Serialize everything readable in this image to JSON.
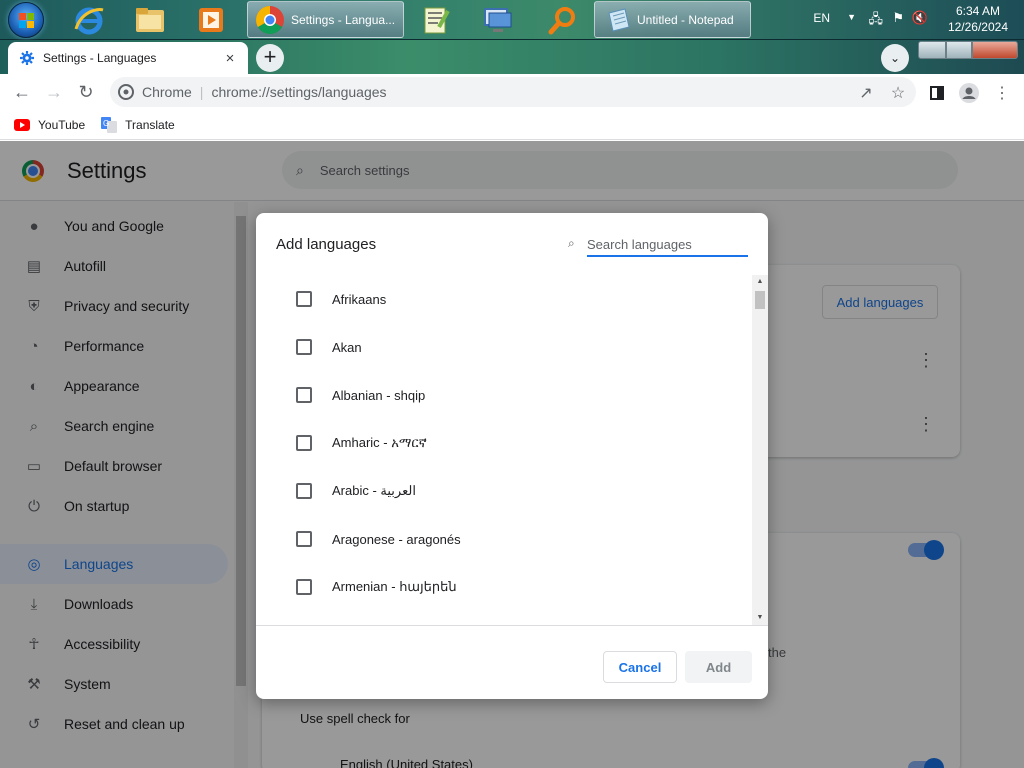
{
  "taskbar": {
    "tasks": [
      {
        "label": "Settings - Langua..."
      },
      {
        "label": "Untitled - Notepad"
      }
    ],
    "tray": {
      "language": "EN",
      "time": "6:34 AM",
      "date": "12/26/2024"
    }
  },
  "browser": {
    "tab_title": "Settings - Languages",
    "close_label": "×",
    "new_tab_label": "+",
    "site_label": "Chrome",
    "url": "chrome://settings/languages",
    "bookmarks": [
      {
        "label": "YouTube",
        "icon": "youtube-icon"
      },
      {
        "label": "Translate",
        "icon": "translate-icon"
      }
    ]
  },
  "settings": {
    "title": "Settings",
    "search_placeholder": "Search settings",
    "sidebar": [
      {
        "label": "You and Google",
        "icon": "person-icon"
      },
      {
        "label": "Autofill",
        "icon": "clipboard-icon"
      },
      {
        "label": "Privacy and security",
        "icon": "shield-icon"
      },
      {
        "label": "Performance",
        "icon": "gauge-icon"
      },
      {
        "label": "Appearance",
        "icon": "palette-icon"
      },
      {
        "label": "Search engine",
        "icon": "search-icon"
      },
      {
        "label": "Default browser",
        "icon": "browser-icon"
      },
      {
        "label": "On startup",
        "icon": "power-icon"
      },
      {
        "label": "Languages",
        "icon": "globe-icon",
        "active": true
      },
      {
        "label": "Downloads",
        "icon": "download-icon"
      },
      {
        "label": "Accessibility",
        "icon": "accessibility-icon"
      },
      {
        "label": "System",
        "icon": "wrench-icon"
      },
      {
        "label": "Reset and clean up",
        "icon": "reset-icon"
      }
    ],
    "add_languages_button": "Add languages",
    "partial_text_the": "the",
    "use_spell_check_for": "Use spell check for",
    "spell_check_language": "English (United States)"
  },
  "dialog": {
    "title": "Add languages",
    "search_placeholder": "Search languages",
    "languages": [
      "Afrikaans",
      "Akan",
      "Albanian - shqip",
      "Amharic - አማርኛ",
      "Arabic - العربية",
      "Aragonese - aragonés",
      "Armenian - հայերեն"
    ],
    "cancel_label": "Cancel",
    "add_label": "Add"
  },
  "colors": {
    "accent": "#1a73e8",
    "text": "#202124",
    "secondary": "#5f6368"
  }
}
